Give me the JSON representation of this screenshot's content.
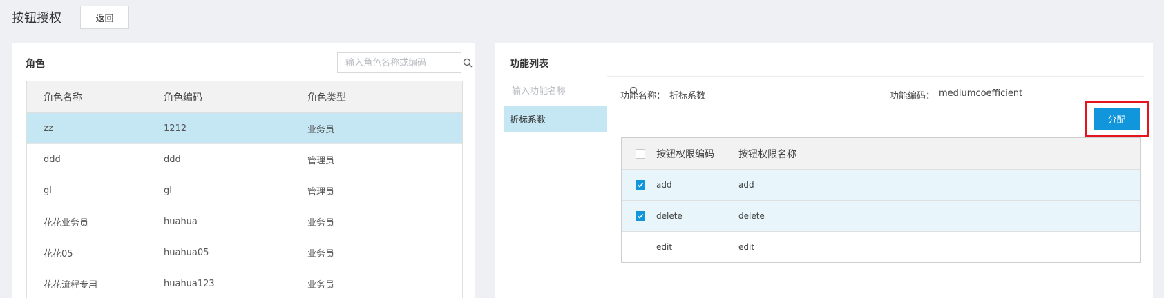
{
  "page": {
    "title": "按钮授权",
    "back_label": "返回"
  },
  "roles": {
    "title": "角色",
    "search_placeholder": "输入角色名称或编码",
    "columns": [
      "角色名称",
      "角色编码",
      "角色类型"
    ],
    "rows": [
      {
        "name": "zz",
        "code": "1212",
        "type": "业务员",
        "selected": true
      },
      {
        "name": "ddd",
        "code": "ddd",
        "type": "管理员"
      },
      {
        "name": "gl",
        "code": "gl",
        "type": "管理员"
      },
      {
        "name": "花花业务员",
        "code": "huahua",
        "type": "业务员"
      },
      {
        "name": "花花05",
        "code": "huahua05",
        "type": "业务员"
      },
      {
        "name": "花花流程专用",
        "code": "huahua123",
        "type": "业务员"
      }
    ]
  },
  "functions": {
    "title": "功能列表",
    "search_placeholder": "输入功能名称",
    "items": [
      "折标系数"
    ],
    "detail": {
      "name_label": "功能名称：",
      "name_value": "折标系数",
      "code_label": "功能编码：",
      "code_value": "mediumcoefficient"
    },
    "assign_label": "分配",
    "columns": [
      "按钮权限编码",
      "按钮权限名称"
    ],
    "rows": [
      {
        "code": "add",
        "name": "add",
        "checked": true
      },
      {
        "code": "delete",
        "name": "delete",
        "checked": true
      },
      {
        "code": "edit",
        "name": "edit",
        "checked": false
      }
    ]
  },
  "colors": {
    "accent": "#1296db",
    "selected_row": "#c4e7f3",
    "highlight": "#e6141e"
  }
}
